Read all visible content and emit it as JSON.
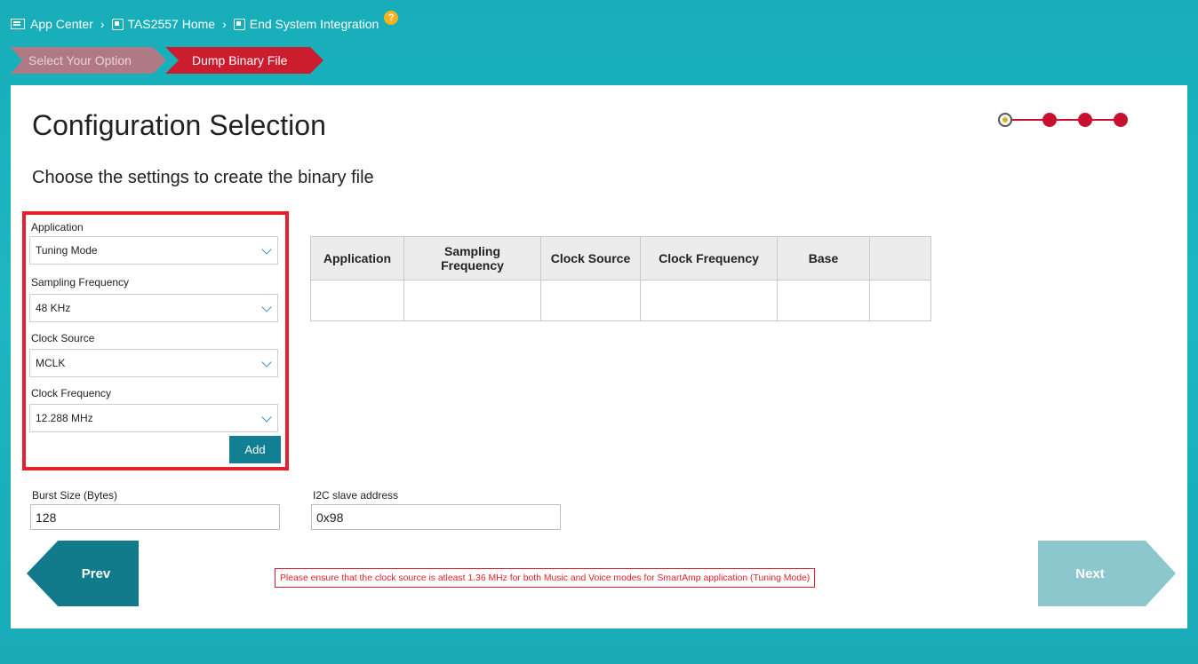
{
  "breadcrumb": {
    "items": [
      "App Center",
      "TAS2557 Home",
      "End System Integration"
    ],
    "separator": "›",
    "help_symbol": "?"
  },
  "wizard": {
    "steps": [
      {
        "label": "Select Your Option",
        "state": "completed"
      },
      {
        "label": "Dump Binary File",
        "state": "active"
      }
    ]
  },
  "page": {
    "title": "Configuration Selection",
    "subtitle": "Choose the settings to create the binary file"
  },
  "form": {
    "application": {
      "label": "Application",
      "value": "Tuning Mode"
    },
    "sampling_frequency": {
      "label": "Sampling Frequency",
      "value": "48 KHz"
    },
    "clock_source": {
      "label": "Clock Source",
      "value": "MCLK"
    },
    "clock_frequency": {
      "label": "Clock Frequency",
      "value": "12.288 MHz"
    },
    "add_label": "Add"
  },
  "table": {
    "headers": [
      "Application",
      "Sampling Frequency",
      "Clock Source",
      "Clock Frequency",
      "Base",
      ""
    ]
  },
  "burst_size": {
    "label": "Burst Size (Bytes)",
    "value": "128"
  },
  "i2c": {
    "label": "I2C slave address",
    "value": "0x98"
  },
  "nav": {
    "prev_label": "Prev",
    "next_label": "Next"
  },
  "warning": "Please ensure that the clock source is atleast 1.36 MHz for both Music and Voice modes for SmartAmp application (Tuning Mode)",
  "colors": {
    "background": "#17aeb9",
    "accent_red": "#cc1d2f",
    "button_teal": "#127f92",
    "next_disabled": "#8cc7ce",
    "help_orange": "#f6b21a"
  }
}
